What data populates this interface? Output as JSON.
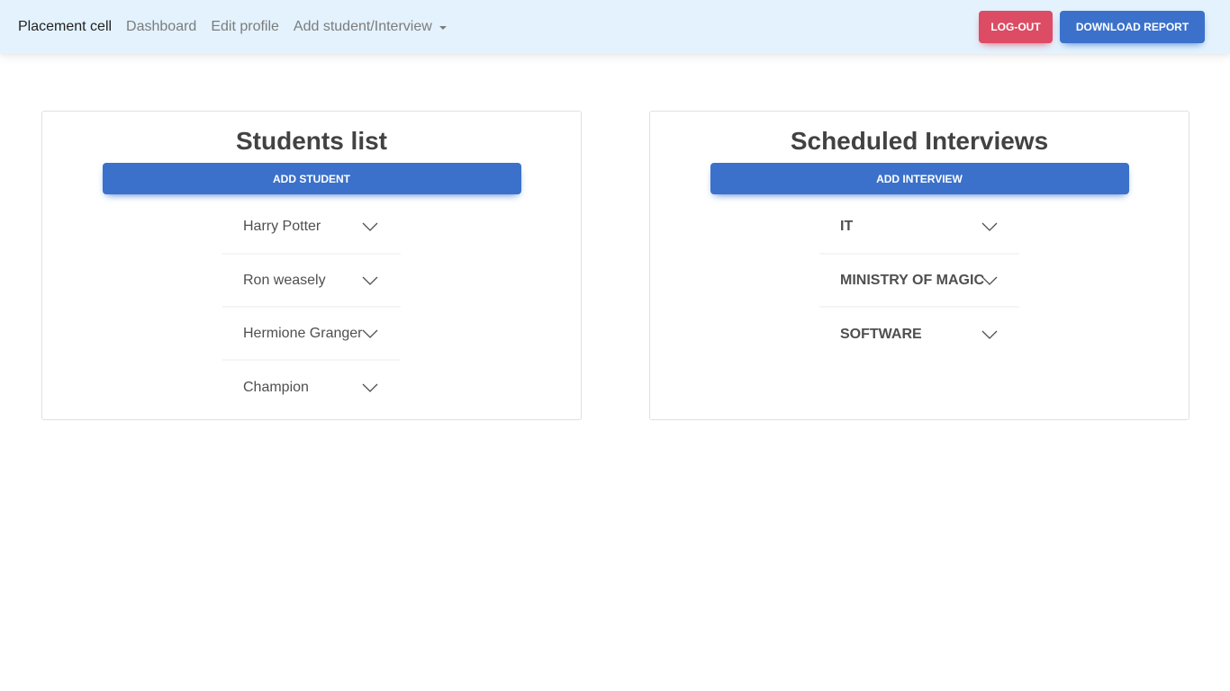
{
  "navbar": {
    "brand": "Placement cell",
    "links": [
      "Dashboard",
      "Edit profile"
    ],
    "dropdown_label": "Add student/Interview",
    "logout_label": "LOG-OUT",
    "download_label": "DOWNLOAD REPORT"
  },
  "students_card": {
    "title": "Students list",
    "button_label": "ADD STUDENT",
    "items": [
      {
        "label": "Harry Potter"
      },
      {
        "label": "Ron weasely"
      },
      {
        "label": "Hermione Granger"
      },
      {
        "label": "Champion"
      }
    ]
  },
  "interviews_card": {
    "title": "Scheduled Interviews",
    "button_label": "ADD INTERVIEW",
    "items": [
      {
        "label": "IT"
      },
      {
        "label": "MINISTRY OF MAGIC"
      },
      {
        "label": "SOFTWARE"
      }
    ]
  },
  "colors": {
    "navbar_bg": "#e3f2fd",
    "primary": "#3b71ca",
    "danger": "#dc4c64"
  },
  "icons": {
    "accordion_toggle": "chevron-down-icon",
    "dropdown_toggle": "caret-down-icon"
  }
}
